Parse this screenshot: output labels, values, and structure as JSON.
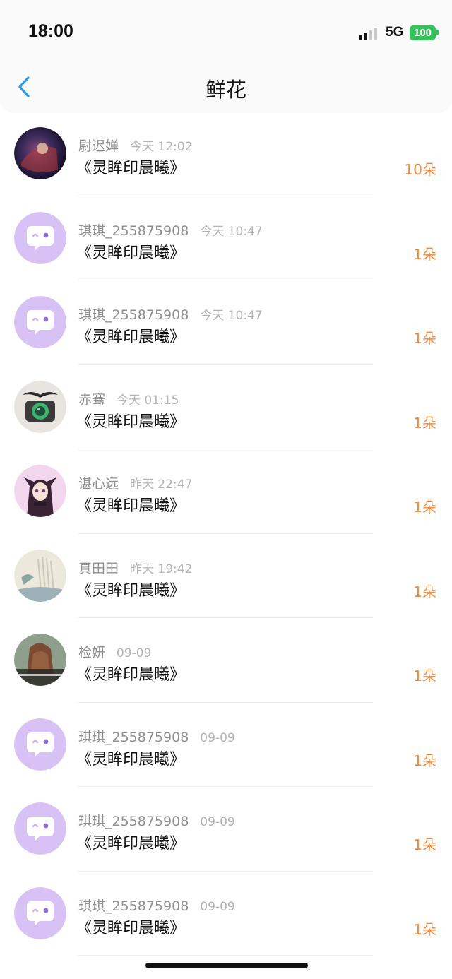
{
  "status_bar": {
    "time": "18:00",
    "network": "5G",
    "battery": "100"
  },
  "header": {
    "title": "鲜花",
    "back_icon": "chevron-left-icon"
  },
  "colors": {
    "accent_blue": "#2f9ae9",
    "amount_orange": "#ef8a3e",
    "battery_green": "#36c25a",
    "default_avatar_purple": "#d8c2f5"
  },
  "items": [
    {
      "username": "尉迟婵",
      "time": "今天 12:02",
      "book": "《灵眸印晨曦》",
      "amount": "10朵",
      "avatar": "photo-dark"
    },
    {
      "username": "琪琪_255875908",
      "time": "今天 10:47",
      "book": "《灵眸印晨曦》",
      "amount": "1朵",
      "avatar": "default-chat-icon"
    },
    {
      "username": "琪琪_255875908",
      "time": "今天 10:47",
      "book": "《灵眸印晨曦》",
      "amount": "1朵",
      "avatar": "default-chat-icon"
    },
    {
      "username": "赤骞",
      "time": "今天 01:15",
      "book": "《灵眸印晨曦》",
      "amount": "1朵",
      "avatar": "photo-camera"
    },
    {
      "username": "谌心远",
      "time": "昨天 22:47",
      "book": "《灵眸印晨曦》",
      "amount": "1朵",
      "avatar": "photo-anime"
    },
    {
      "username": "真田田",
      "time": "昨天 19:42",
      "book": "《灵眸印晨曦》",
      "amount": "1朵",
      "avatar": "photo-sketch"
    },
    {
      "username": "检妍",
      "time": "09-09",
      "book": "《灵眸印晨曦》",
      "amount": "1朵",
      "avatar": "photo-girl"
    },
    {
      "username": "琪琪_255875908",
      "time": "09-09",
      "book": "《灵眸印晨曦》",
      "amount": "1朵",
      "avatar": "default-chat-icon"
    },
    {
      "username": "琪琪_255875908",
      "time": "09-09",
      "book": "《灵眸印晨曦》",
      "amount": "1朵",
      "avatar": "default-chat-icon"
    },
    {
      "username": "琪琪_255875908",
      "time": "09-09",
      "book": "《灵眸印晨曦》",
      "amount": "1朵",
      "avatar": "default-chat-icon"
    }
  ]
}
